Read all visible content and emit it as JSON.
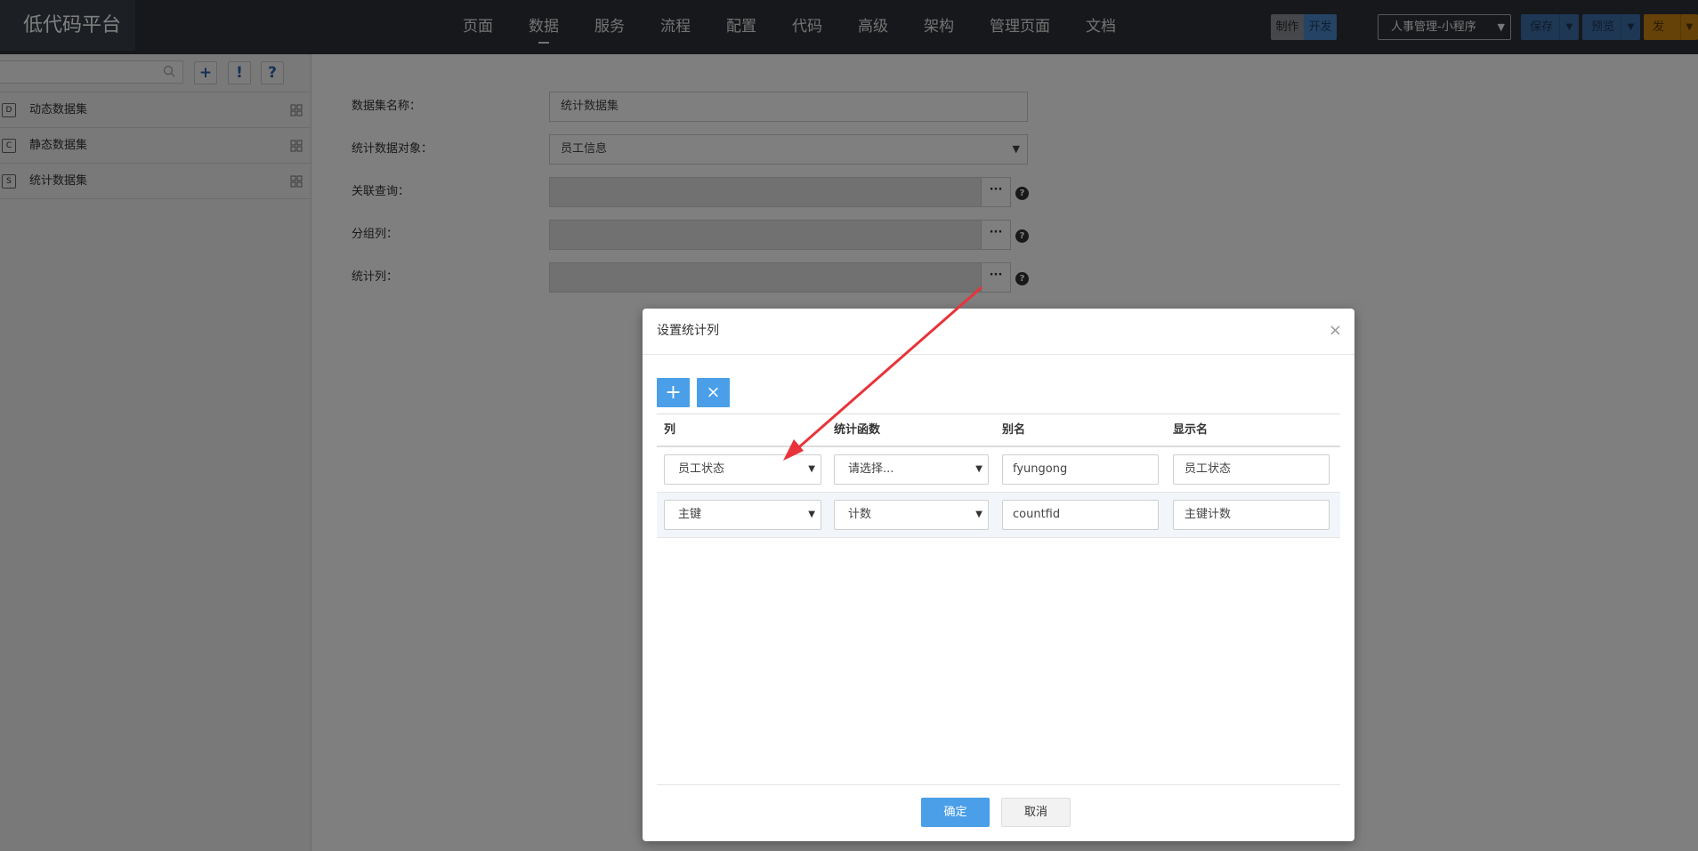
{
  "app": {
    "logo": "低代码平台"
  },
  "nav": [
    {
      "label": "页面"
    },
    {
      "label": "数据",
      "active": true
    },
    {
      "label": "服务"
    },
    {
      "label": "流程"
    },
    {
      "label": "配置"
    },
    {
      "label": "代码"
    },
    {
      "label": "高级"
    },
    {
      "label": "架构"
    },
    {
      "label": "管理页面"
    },
    {
      "label": "文档"
    }
  ],
  "toolbar": {
    "mode_make": "制作",
    "mode_dev": "开发",
    "app_select": "人事管理-小程序",
    "save": "保存",
    "preview": "预览",
    "publish": "发布"
  },
  "sidebar": {
    "buttons": {
      "add": "+",
      "alert": "!",
      "help": "?"
    },
    "items": [
      {
        "label": "动态数据集",
        "icon_letter": "D"
      },
      {
        "label": "静态数据集",
        "icon_letter": "C"
      },
      {
        "label": "统计数据集",
        "icon_letter": "S"
      }
    ]
  },
  "form": {
    "name_label": "数据集名称：",
    "name_value": "统计数据集",
    "object_label": "统计数据对象：",
    "object_value": "员工信息",
    "join_label": "关联查询：",
    "group_label": "分组列：",
    "stat_label": "统计列：",
    "dots": "···",
    "help": "?"
  },
  "modal": {
    "title": "设置统计列",
    "close": "×",
    "add": "+",
    "delete": "×",
    "columns": [
      "列",
      "统计函数",
      "别名",
      "显示名"
    ],
    "rows": [
      {
        "column": "员工状态",
        "func": "请选择...",
        "alias": "fyungong",
        "display": "员工状态"
      },
      {
        "column": "主键",
        "func": "计数",
        "alias": "countfid",
        "display": "主键计数"
      }
    ],
    "ok": "确定",
    "cancel": "取消"
  },
  "colors": {
    "topbar": "#2c3037",
    "primary": "#4a9fe8",
    "annotation_arrow": "#e8333a"
  }
}
